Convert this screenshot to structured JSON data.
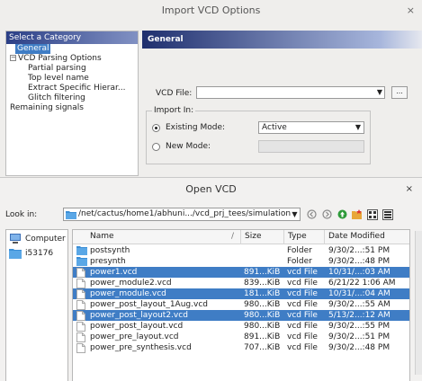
{
  "import_dialog": {
    "title": "Import VCD Options",
    "close_glyph": "×",
    "category_header": "Select a Category",
    "tree": [
      {
        "label": "General",
        "level": 0,
        "selected": true
      },
      {
        "label": "VCD Parsing Options",
        "level": 0,
        "toggle": "−"
      },
      {
        "label": "Partial parsing",
        "level": 2
      },
      {
        "label": "Top level name",
        "level": 2
      },
      {
        "label": "Extract Specific Hierar...",
        "level": 2
      },
      {
        "label": "Glitch filtering",
        "level": 2
      },
      {
        "label": "Remaining signals",
        "level": 0
      }
    ],
    "general_header": "General",
    "vcd_file_label": "VCD File:",
    "vcd_file_value": "",
    "browse_label": "...",
    "import_in_legend": "Import In:",
    "existing_mode_label": "Existing Mode:",
    "existing_mode_value": "Active",
    "new_mode_label": "New Mode:",
    "new_mode_value": "",
    "existing_mode_checked": true
  },
  "open_dialog": {
    "title": "Open VCD",
    "close_glyph": "×",
    "look_in_label": "Look in:",
    "path": "/net/cactus/home1/abhuni.../vcd_prj_tees/simulation",
    "toolbar_icons": [
      "back-icon",
      "forward-icon",
      "parent-dir-icon",
      "new-folder-icon",
      "list-view-icon",
      "detail-view-icon"
    ],
    "places": [
      {
        "label": "Computer",
        "icon": "computer-icon"
      },
      {
        "label": "i53176",
        "icon": "folder-icon"
      }
    ],
    "columns": [
      "Name",
      "Size",
      "Type",
      "Date Modified"
    ],
    "sort_glyph": "/",
    "files": [
      {
        "name": "postsynth",
        "size": "",
        "type": "Folder",
        "date": "9/30/2...:51 PM",
        "kind": "folder",
        "selected": false
      },
      {
        "name": "presynth",
        "size": "",
        "type": "Folder",
        "date": "9/30/2...:48 PM",
        "kind": "folder",
        "selected": false
      },
      {
        "name": "power1.vcd",
        "size": "891...KiB",
        "type": "vcd File",
        "date": "10/31/...:03 AM",
        "kind": "file",
        "selected": true
      },
      {
        "name": "power_module2.vcd",
        "size": "839...KiB",
        "type": "vcd File",
        "date": "6/21/22 1:06 AM",
        "kind": "file",
        "selected": false
      },
      {
        "name": "power_module.vcd",
        "size": "181...KiB",
        "type": "vcd File",
        "date": "10/31/...:04 AM",
        "kind": "file",
        "selected": true
      },
      {
        "name": "power_post_layout_1Aug.vcd",
        "size": "980...KiB",
        "type": "vcd File",
        "date": "9/30/2...:55 AM",
        "kind": "file",
        "selected": false
      },
      {
        "name": "power_post_layout2.vcd",
        "size": "980...KiB",
        "type": "vcd File",
        "date": "5/13/2...:12 AM",
        "kind": "file",
        "selected": true
      },
      {
        "name": "power_post_layout.vcd",
        "size": "980...KiB",
        "type": "vcd File",
        "date": "9/30/2...:55 PM",
        "kind": "file",
        "selected": false
      },
      {
        "name": "power_pre_layout.vcd",
        "size": "891...KiB",
        "type": "vcd File",
        "date": "9/30/2...:51 PM",
        "kind": "file",
        "selected": false
      },
      {
        "name": "power_pre_synthesis.vcd",
        "size": "707...KiB",
        "type": "vcd File",
        "date": "9/30/2...:48 PM",
        "kind": "file",
        "selected": false
      }
    ]
  },
  "colors": {
    "selection": "#3f7dc5",
    "header_dark": "#1f2f6e",
    "folder_blue": "#3b8ed6"
  }
}
